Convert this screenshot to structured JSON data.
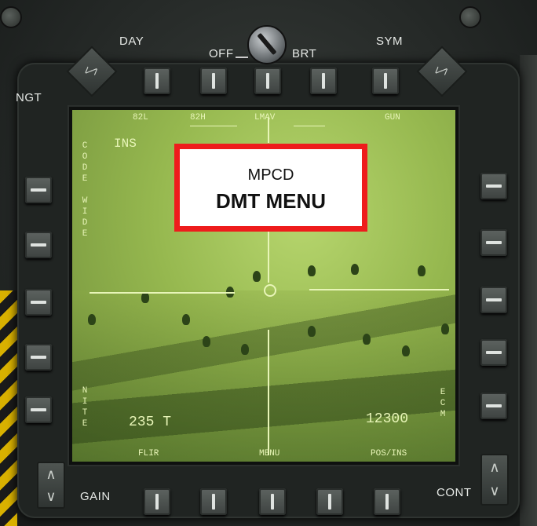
{
  "bezel": {
    "labels": {
      "day": "DAY",
      "off": "OFF",
      "brt": "BRT",
      "sym": "SYM",
      "ngt": "NGT",
      "gain": "GAIN",
      "cont": "CONT"
    },
    "rocker_symbols": {
      "up": "∧",
      "down": "∨",
      "left": "<",
      "right": ">"
    }
  },
  "display": {
    "top_options": [
      "82L",
      "82H",
      "LMAV",
      "",
      "GUN"
    ],
    "bottom_options": [
      "FLIR",
      "MENU",
      "POS/INS"
    ],
    "nav_mode": "INS",
    "left_vertical_top": "CODE WIDE",
    "left_vertical_bottom": "NITE",
    "right_vertical_bottom": "ECM",
    "heading": "235 T",
    "altitude": "12300"
  },
  "callout": {
    "line1": "MPCD",
    "line2": "DMT MENU",
    "border_color": "#ee1c1c"
  },
  "colors": {
    "screen_green": "#9dbf55",
    "symbology": "#e8f5b8"
  }
}
